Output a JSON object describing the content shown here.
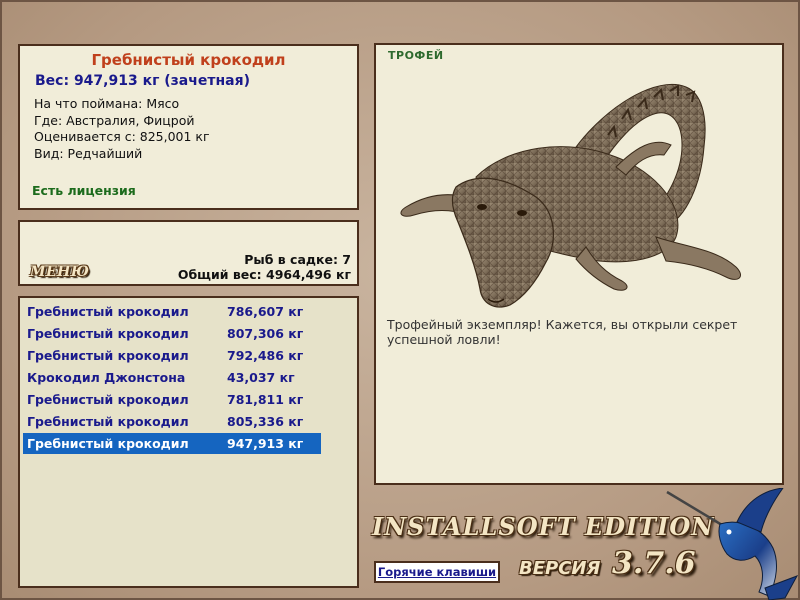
{
  "info": {
    "title": "Гребнистый крокодил",
    "weight": "Вес: 947,913 кг (зачетная)",
    "bait": "На что поймана: Мясо",
    "location": "Где: Австралия, Фицрой",
    "rated_from": "Оценивается с: 825,001 кг",
    "rarity": "Вид: Редчайший",
    "license": "Есть лицензия"
  },
  "keep": {
    "menu_label": "МЕНЮ",
    "fish_count": "Рыб в садке: 7",
    "total_weight": "Общий вес: 4964,496 кг"
  },
  "catches": [
    {
      "name": "Гребнистый крокодил",
      "weight": "786,607 кг"
    },
    {
      "name": "Гребнистый крокодил",
      "weight": "807,306 кг"
    },
    {
      "name": "Гребнистый крокодил",
      "weight": "792,486 кг"
    },
    {
      "name": "Крокодил Джонстона",
      "weight": "43,037 кг"
    },
    {
      "name": "Гребнистый крокодил",
      "weight": "781,811 кг"
    },
    {
      "name": "Гребнистый крокодил",
      "weight": "805,336 кг"
    },
    {
      "name": "Гребнистый крокодил",
      "weight": "947,913 кг"
    }
  ],
  "selected_index": 6,
  "trophy": {
    "tag": "ТРОФЕЙ",
    "description": "Трофейный экземпляр! Кажется, вы открыли секрет успешной ловли!"
  },
  "branding": {
    "edition": "INSTALLSOFT EDITION",
    "version_label": "ВЕРСИЯ",
    "version": "3.7.6"
  },
  "hotkeys_label": "Горячие клавиши",
  "colors": {
    "title": "#c0401c",
    "weight": "#1a1a8c",
    "license": "#1c6b1c",
    "selection": "#1565c0",
    "panel_bg": "#f1edd9",
    "panel_border": "#4a2e1c"
  }
}
